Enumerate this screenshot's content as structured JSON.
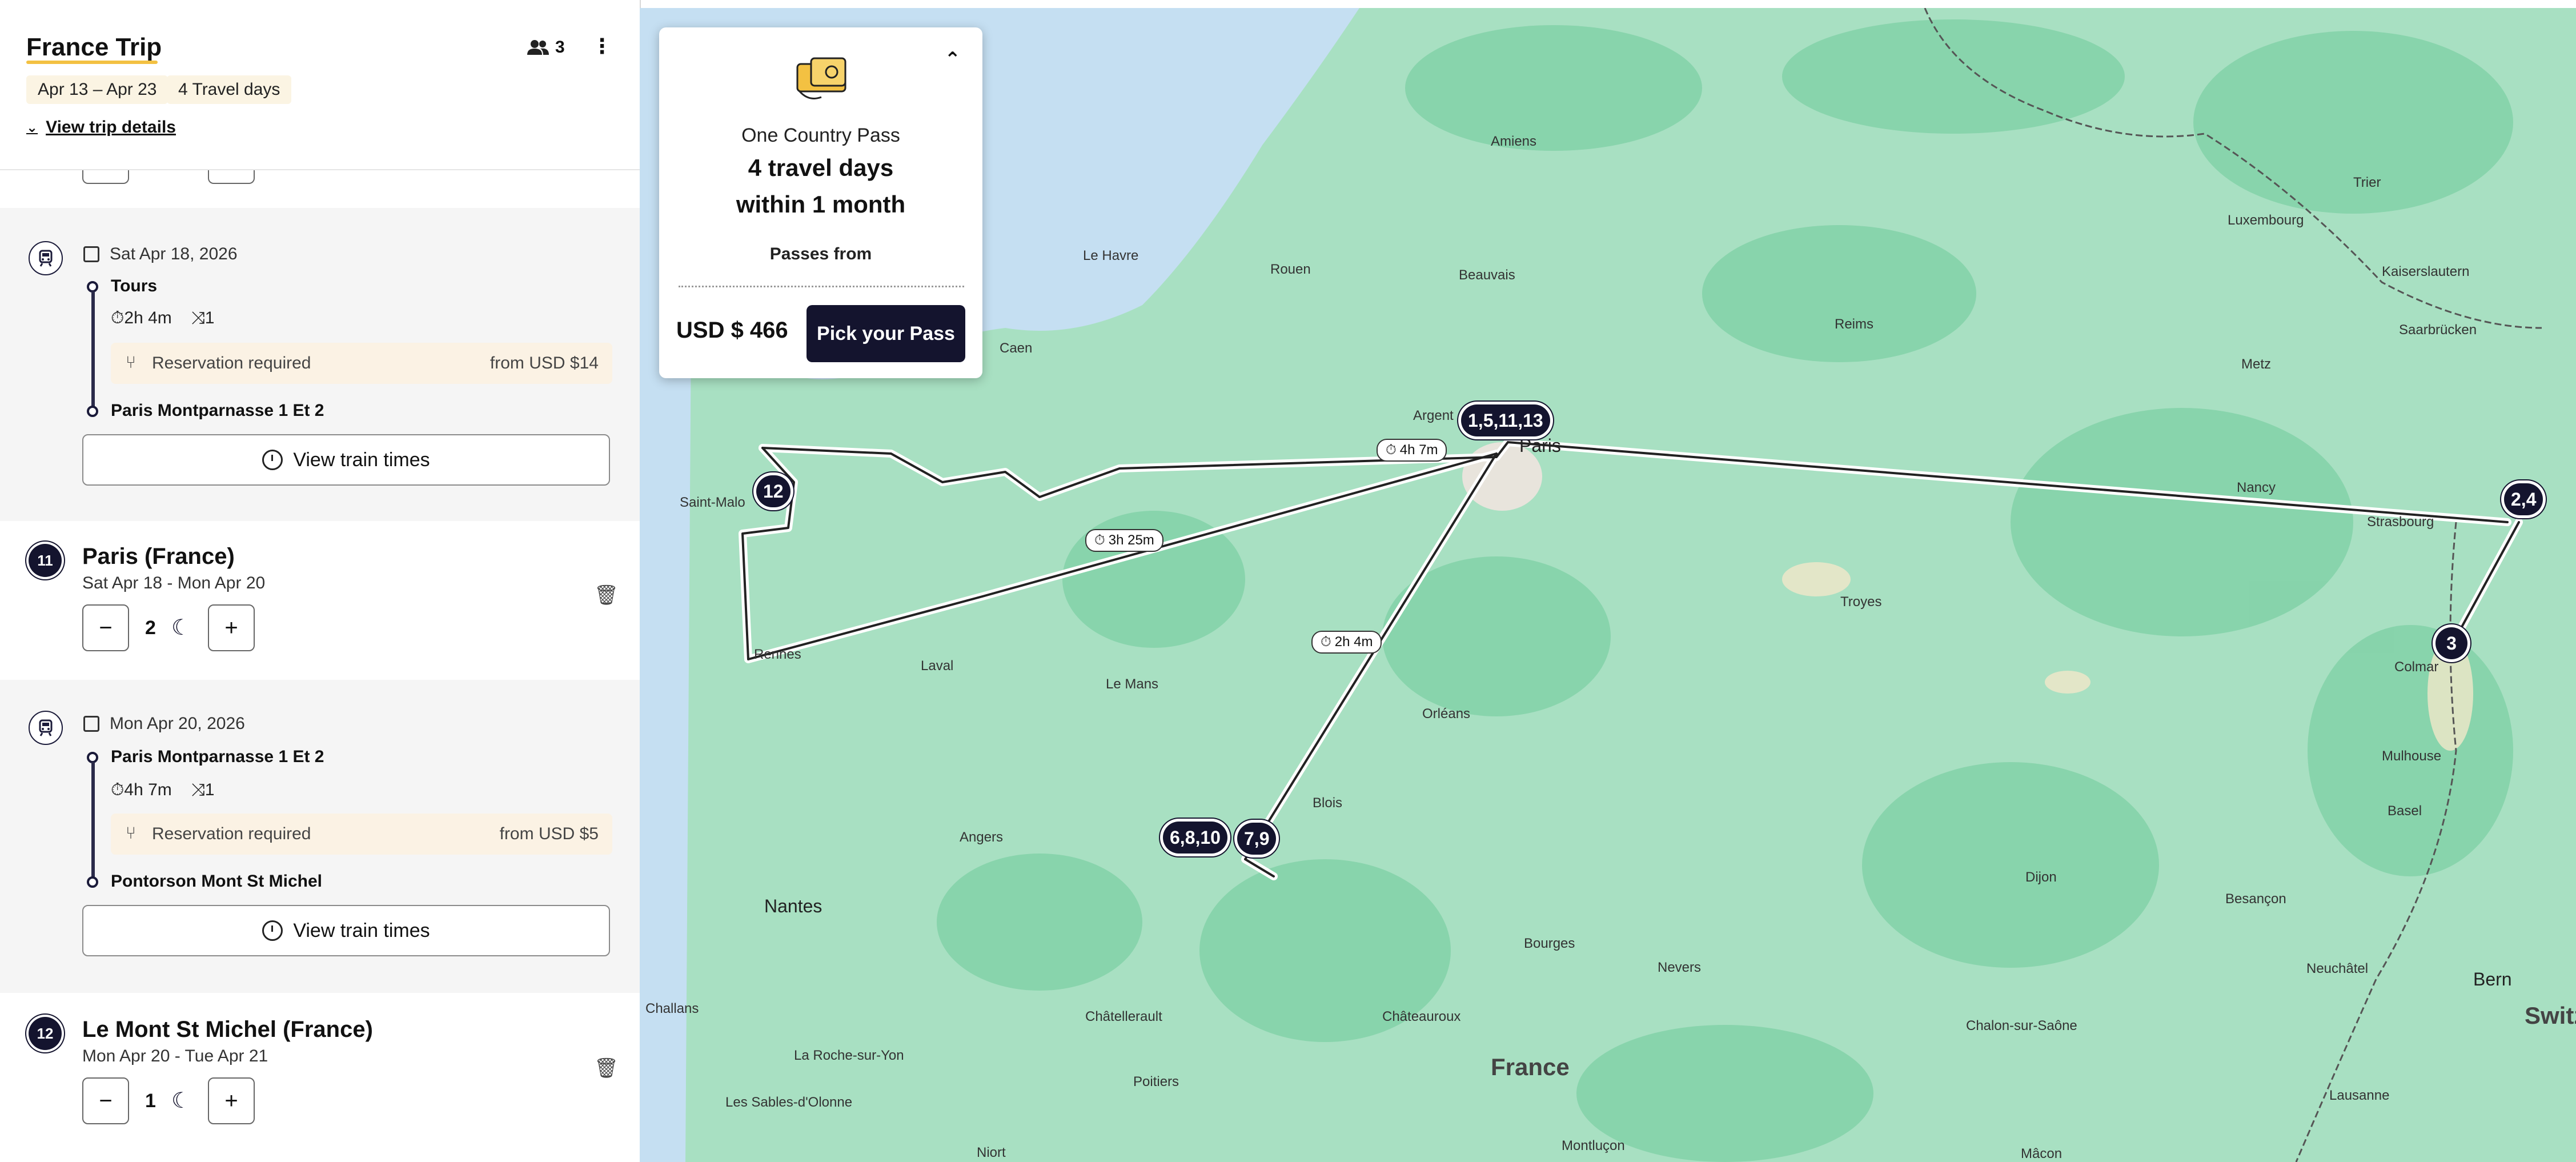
{
  "trip": {
    "title": "France Trip",
    "travelers": "3",
    "dates": "Apr 13 – Apr 23",
    "travel_days": "4 Travel days",
    "details_link": "View trip details"
  },
  "legs": [
    {
      "date": "Sat Apr 18, 2026",
      "from": "Tours",
      "duration": "2h 4m",
      "changes": "1",
      "reservation": "Reservation required",
      "price": "from USD $14",
      "to": "Paris Montparnasse 1 Et 2",
      "button": "View train times"
    },
    {
      "date": "Mon Apr 20, 2026",
      "from": "Paris Montparnasse 1 Et 2",
      "duration": "4h 7m",
      "changes": "1",
      "reservation": "Reservation required",
      "price": "from USD $5",
      "to": "Pontorson Mont St Michel",
      "button": "View train times"
    }
  ],
  "stops": [
    {
      "number": "11",
      "name": "Paris (France)",
      "dates": "Sat Apr 18 - Mon Apr 20",
      "nights": "2"
    },
    {
      "number": "12",
      "name": "Le Mont St Michel (France)",
      "dates": "Mon Apr 20 - Tue Apr 21",
      "nights": "1"
    }
  ],
  "stepper": {
    "minus": "−",
    "plus": "+"
  },
  "pass": {
    "name": "One Country Pass",
    "headline1": "4 travel days",
    "headline2": "within 1 month",
    "from_label": "Passes from",
    "price": "USD $ 466",
    "cta": "Pick your Pass"
  },
  "map": {
    "cities": {
      "amiens": "Amiens",
      "le_havre": "Le Havre",
      "rouen": "Rouen",
      "beauvais": "Beauvais",
      "caen": "Caen",
      "reims": "Reims",
      "metz": "Metz",
      "luxembourg": "Luxembourg",
      "trier": "Trier",
      "kaiserslautern": "Kaiserslautern",
      "saarbrucken": "Saarbrücken",
      "nancy": "Nancy",
      "strasbourg": "Strasbourg",
      "troyes": "Troyes",
      "colmar": "Colmar",
      "mulhouse": "Mulhouse",
      "basel": "Basel",
      "saint_malo": "Saint-Malo",
      "rennes": "Rennes",
      "laval": "Laval",
      "le_mans": "Le Mans",
      "orleans": "Orléans",
      "blois": "Blois",
      "angers": "Angers",
      "nantes": "Nantes",
      "dijon": "Dijon",
      "besancon": "Besançon",
      "bourges": "Bourges",
      "nevers": "Nevers",
      "chatellerault": "Châtellerault",
      "chateauroux": "Châteauroux",
      "challans": "Challans",
      "la_roche": "La Roche-sur-Yon",
      "poitiers": "Poitiers",
      "les_sables": "Les Sables-d'Olonne",
      "chalon": "Chalon-sur-Saône",
      "neuchatel": "Neuchâtel",
      "bern": "Bern",
      "lausanne": "Lausanne",
      "montlucon": "Montluçon",
      "niort": "Niort",
      "macon": "Mâcon",
      "paris": "Paris",
      "argenteuil": "Argent",
      "france": "France",
      "switz": "Switz"
    },
    "badges": {
      "paris": "1,5,11,13",
      "strasbourg": "2,4",
      "colmar": "3",
      "tours": "6,8,10",
      "blois_stop": "7,9",
      "mont_st_michel": "12"
    },
    "durations": {
      "paris_msm": "4h 7m",
      "rennes_paris": "3h 25m",
      "tours_paris": "2h 4m"
    }
  }
}
